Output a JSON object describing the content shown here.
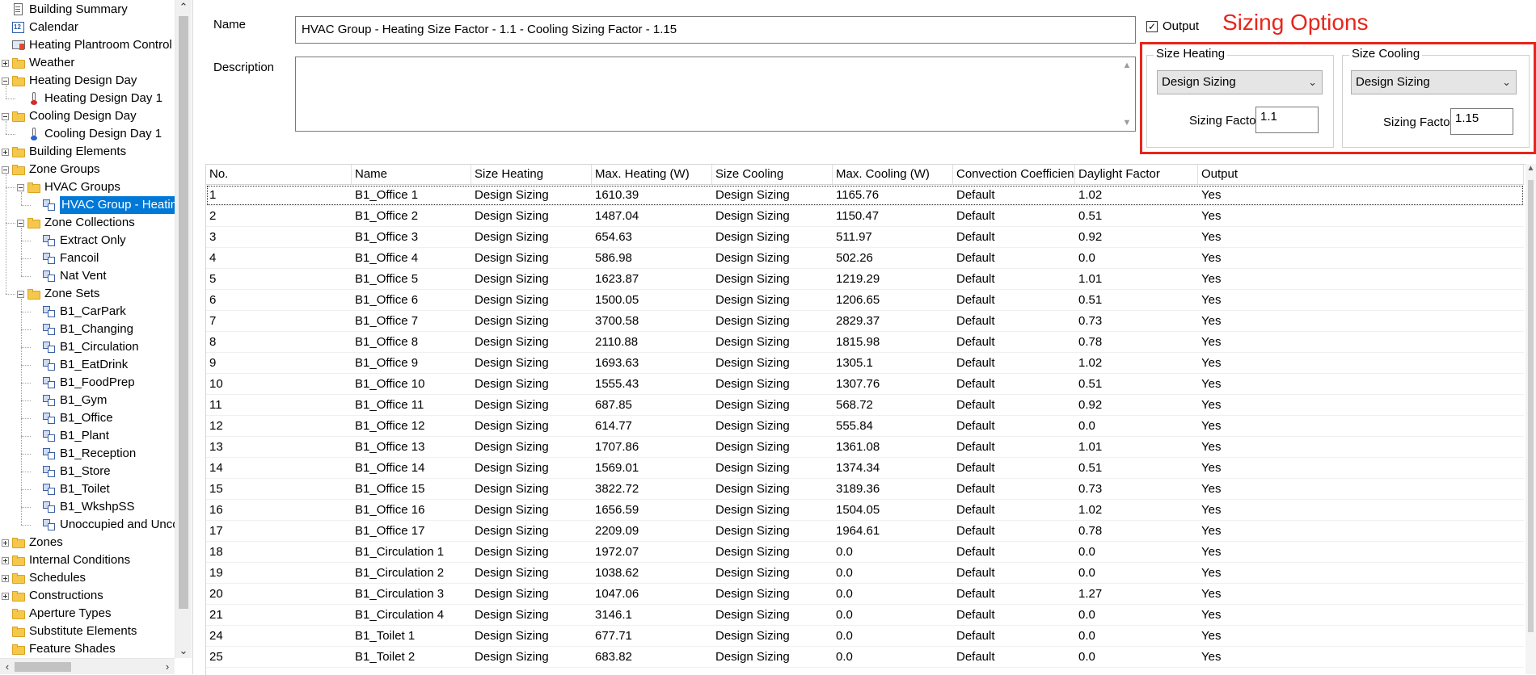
{
  "tree": {
    "items": [
      {
        "label": "Building Summary",
        "icon": "document-icon",
        "expander": "",
        "depth": 0
      },
      {
        "label": "Calendar",
        "icon": "calendar-icon",
        "expander": "",
        "depth": 0
      },
      {
        "label": "Heating Plantroom Control",
        "icon": "plantroom-icon",
        "expander": "",
        "depth": 0
      },
      {
        "label": "Weather",
        "icon": "folder-icon",
        "expander": "plus",
        "depth": 0
      },
      {
        "label": "Heating Design Day",
        "icon": "folder-icon",
        "expander": "minus",
        "depth": 0
      },
      {
        "label": "Heating Design Day 1",
        "icon": "thermometer-hot-icon",
        "expander": "",
        "depth": 1
      },
      {
        "label": "Cooling Design Day",
        "icon": "folder-icon",
        "expander": "minus",
        "depth": 0
      },
      {
        "label": "Cooling Design Day 1",
        "icon": "thermometer-cold-icon",
        "expander": "",
        "depth": 1
      },
      {
        "label": "Building Elements",
        "icon": "folder-icon",
        "expander": "plus",
        "depth": 0
      },
      {
        "label": "Zone Groups",
        "icon": "folder-icon",
        "expander": "minus",
        "depth": 0
      },
      {
        "label": "HVAC Groups",
        "icon": "folder-icon",
        "expander": "minus",
        "depth": 1
      },
      {
        "label": "HVAC Group - Heating",
        "icon": "zone-group-icon",
        "expander": "",
        "depth": 2,
        "selected": true
      },
      {
        "label": "Zone Collections",
        "icon": "folder-icon",
        "expander": "minus",
        "depth": 1
      },
      {
        "label": "Extract Only",
        "icon": "zone-group-icon",
        "expander": "",
        "depth": 2
      },
      {
        "label": "Fancoil",
        "icon": "zone-group-icon",
        "expander": "",
        "depth": 2
      },
      {
        "label": "Nat Vent",
        "icon": "zone-group-icon",
        "expander": "",
        "depth": 2
      },
      {
        "label": "Zone Sets",
        "icon": "folder-icon",
        "expander": "minus",
        "depth": 1
      },
      {
        "label": "B1_CarPark",
        "icon": "zone-group-icon",
        "expander": "",
        "depth": 2
      },
      {
        "label": "B1_Changing",
        "icon": "zone-group-icon",
        "expander": "",
        "depth": 2
      },
      {
        "label": "B1_Circulation",
        "icon": "zone-group-icon",
        "expander": "",
        "depth": 2
      },
      {
        "label": "B1_EatDrink",
        "icon": "zone-group-icon",
        "expander": "",
        "depth": 2
      },
      {
        "label": "B1_FoodPrep",
        "icon": "zone-group-icon",
        "expander": "",
        "depth": 2
      },
      {
        "label": "B1_Gym",
        "icon": "zone-group-icon",
        "expander": "",
        "depth": 2
      },
      {
        "label": "B1_Office",
        "icon": "zone-group-icon",
        "expander": "",
        "depth": 2
      },
      {
        "label": "B1_Plant",
        "icon": "zone-group-icon",
        "expander": "",
        "depth": 2
      },
      {
        "label": "B1_Reception",
        "icon": "zone-group-icon",
        "expander": "",
        "depth": 2
      },
      {
        "label": "B1_Store",
        "icon": "zone-group-icon",
        "expander": "",
        "depth": 2
      },
      {
        "label": "B1_Toilet",
        "icon": "zone-group-icon",
        "expander": "",
        "depth": 2
      },
      {
        "label": "B1_WkshpSS",
        "icon": "zone-group-icon",
        "expander": "",
        "depth": 2
      },
      {
        "label": "Unoccupied and Unconditioned",
        "icon": "zone-group-icon",
        "expander": "",
        "depth": 2
      },
      {
        "label": "Zones",
        "icon": "folder-icon",
        "expander": "plus",
        "depth": 0
      },
      {
        "label": "Internal Conditions",
        "icon": "folder-icon",
        "expander": "plus",
        "depth": 0
      },
      {
        "label": "Schedules",
        "icon": "folder-icon",
        "expander": "plus",
        "depth": 0
      },
      {
        "label": "Constructions",
        "icon": "folder-icon",
        "expander": "plus",
        "depth": 0
      },
      {
        "label": "Aperture Types",
        "icon": "folder-icon",
        "expander": "",
        "depth": 0
      },
      {
        "label": "Substitute Elements",
        "icon": "folder-icon",
        "expander": "",
        "depth": 0
      },
      {
        "label": "Feature Shades",
        "icon": "folder-icon",
        "expander": "",
        "depth": 0
      }
    ]
  },
  "form": {
    "name_label": "Name",
    "name_value": "HVAC Group - Heating Size Factor - 1.1 - Cooling Sizing Factor -  1.15",
    "description_label": "Description",
    "description_value": "",
    "output_label": "Output",
    "output_checked": true
  },
  "sizing": {
    "title": "Sizing Options",
    "accent_color": "#e8251b",
    "heating": {
      "group_label": "Size Heating",
      "mode": "Design Sizing",
      "factor_label": "Sizing Factor",
      "factor_value": "1.1"
    },
    "cooling": {
      "group_label": "Size Cooling",
      "mode": "Design Sizing",
      "factor_label": "Sizing Factor",
      "factor_value": "1.15"
    }
  },
  "grid": {
    "columns": [
      "No.",
      "Name",
      "Size Heating",
      "Max. Heating (W)",
      "Size Cooling",
      "Max. Cooling (W)",
      "Convection Coefficient (...",
      "Daylight Factor",
      "Output"
    ],
    "rows": [
      [
        "1",
        "B1_Office 1",
        "Design Sizing",
        "1610.39",
        "Design Sizing",
        "1165.76",
        "Default",
        "1.02",
        "Yes"
      ],
      [
        "2",
        "B1_Office 2",
        "Design Sizing",
        "1487.04",
        "Design Sizing",
        "1150.47",
        "Default",
        "0.51",
        "Yes"
      ],
      [
        "3",
        "B1_Office 3",
        "Design Sizing",
        "654.63",
        "Design Sizing",
        "511.97",
        "Default",
        "0.92",
        "Yes"
      ],
      [
        "4",
        "B1_Office 4",
        "Design Sizing",
        "586.98",
        "Design Sizing",
        "502.26",
        "Default",
        "0.0",
        "Yes"
      ],
      [
        "5",
        "B1_Office 5",
        "Design Sizing",
        "1623.87",
        "Design Sizing",
        "1219.29",
        "Default",
        "1.01",
        "Yes"
      ],
      [
        "6",
        "B1_Office 6",
        "Design Sizing",
        "1500.05",
        "Design Sizing",
        "1206.65",
        "Default",
        "0.51",
        "Yes"
      ],
      [
        "7",
        "B1_Office 7",
        "Design Sizing",
        "3700.58",
        "Design Sizing",
        "2829.37",
        "Default",
        "0.73",
        "Yes"
      ],
      [
        "8",
        "B1_Office 8",
        "Design Sizing",
        "2110.88",
        "Design Sizing",
        "1815.98",
        "Default",
        "0.78",
        "Yes"
      ],
      [
        "9",
        "B1_Office 9",
        "Design Sizing",
        "1693.63",
        "Design Sizing",
        "1305.1",
        "Default",
        "1.02",
        "Yes"
      ],
      [
        "10",
        "B1_Office 10",
        "Design Sizing",
        "1555.43",
        "Design Sizing",
        "1307.76",
        "Default",
        "0.51",
        "Yes"
      ],
      [
        "11",
        "B1_Office 11",
        "Design Sizing",
        "687.85",
        "Design Sizing",
        "568.72",
        "Default",
        "0.92",
        "Yes"
      ],
      [
        "12",
        "B1_Office 12",
        "Design Sizing",
        "614.77",
        "Design Sizing",
        "555.84",
        "Default",
        "0.0",
        "Yes"
      ],
      [
        "13",
        "B1_Office 13",
        "Design Sizing",
        "1707.86",
        "Design Sizing",
        "1361.08",
        "Default",
        "1.01",
        "Yes"
      ],
      [
        "14",
        "B1_Office 14",
        "Design Sizing",
        "1569.01",
        "Design Sizing",
        "1374.34",
        "Default",
        "0.51",
        "Yes"
      ],
      [
        "15",
        "B1_Office 15",
        "Design Sizing",
        "3822.72",
        "Design Sizing",
        "3189.36",
        "Default",
        "0.73",
        "Yes"
      ],
      [
        "16",
        "B1_Office 16",
        "Design Sizing",
        "1656.59",
        "Design Sizing",
        "1504.05",
        "Default",
        "1.02",
        "Yes"
      ],
      [
        "17",
        "B1_Office 17",
        "Design Sizing",
        "2209.09",
        "Design Sizing",
        "1964.61",
        "Default",
        "0.78",
        "Yes"
      ],
      [
        "18",
        "B1_Circulation 1",
        "Design Sizing",
        "1972.07",
        "Design Sizing",
        "0.0",
        "Default",
        "0.0",
        "Yes"
      ],
      [
        "19",
        "B1_Circulation 2",
        "Design Sizing",
        "1038.62",
        "Design Sizing",
        "0.0",
        "Default",
        "0.0",
        "Yes"
      ],
      [
        "20",
        "B1_Circulation 3",
        "Design Sizing",
        "1047.06",
        "Design Sizing",
        "0.0",
        "Default",
        "1.27",
        "Yes"
      ],
      [
        "21",
        "B1_Circulation 4",
        "Design Sizing",
        "3146.1",
        "Design Sizing",
        "0.0",
        "Default",
        "0.0",
        "Yes"
      ],
      [
        "24",
        "B1_Toilet 1",
        "Design Sizing",
        "677.71",
        "Design Sizing",
        "0.0",
        "Default",
        "0.0",
        "Yes"
      ],
      [
        "25",
        "B1_Toilet 2",
        "Design Sizing",
        "683.82",
        "Design Sizing",
        "0.0",
        "Default",
        "0.0",
        "Yes"
      ]
    ]
  }
}
